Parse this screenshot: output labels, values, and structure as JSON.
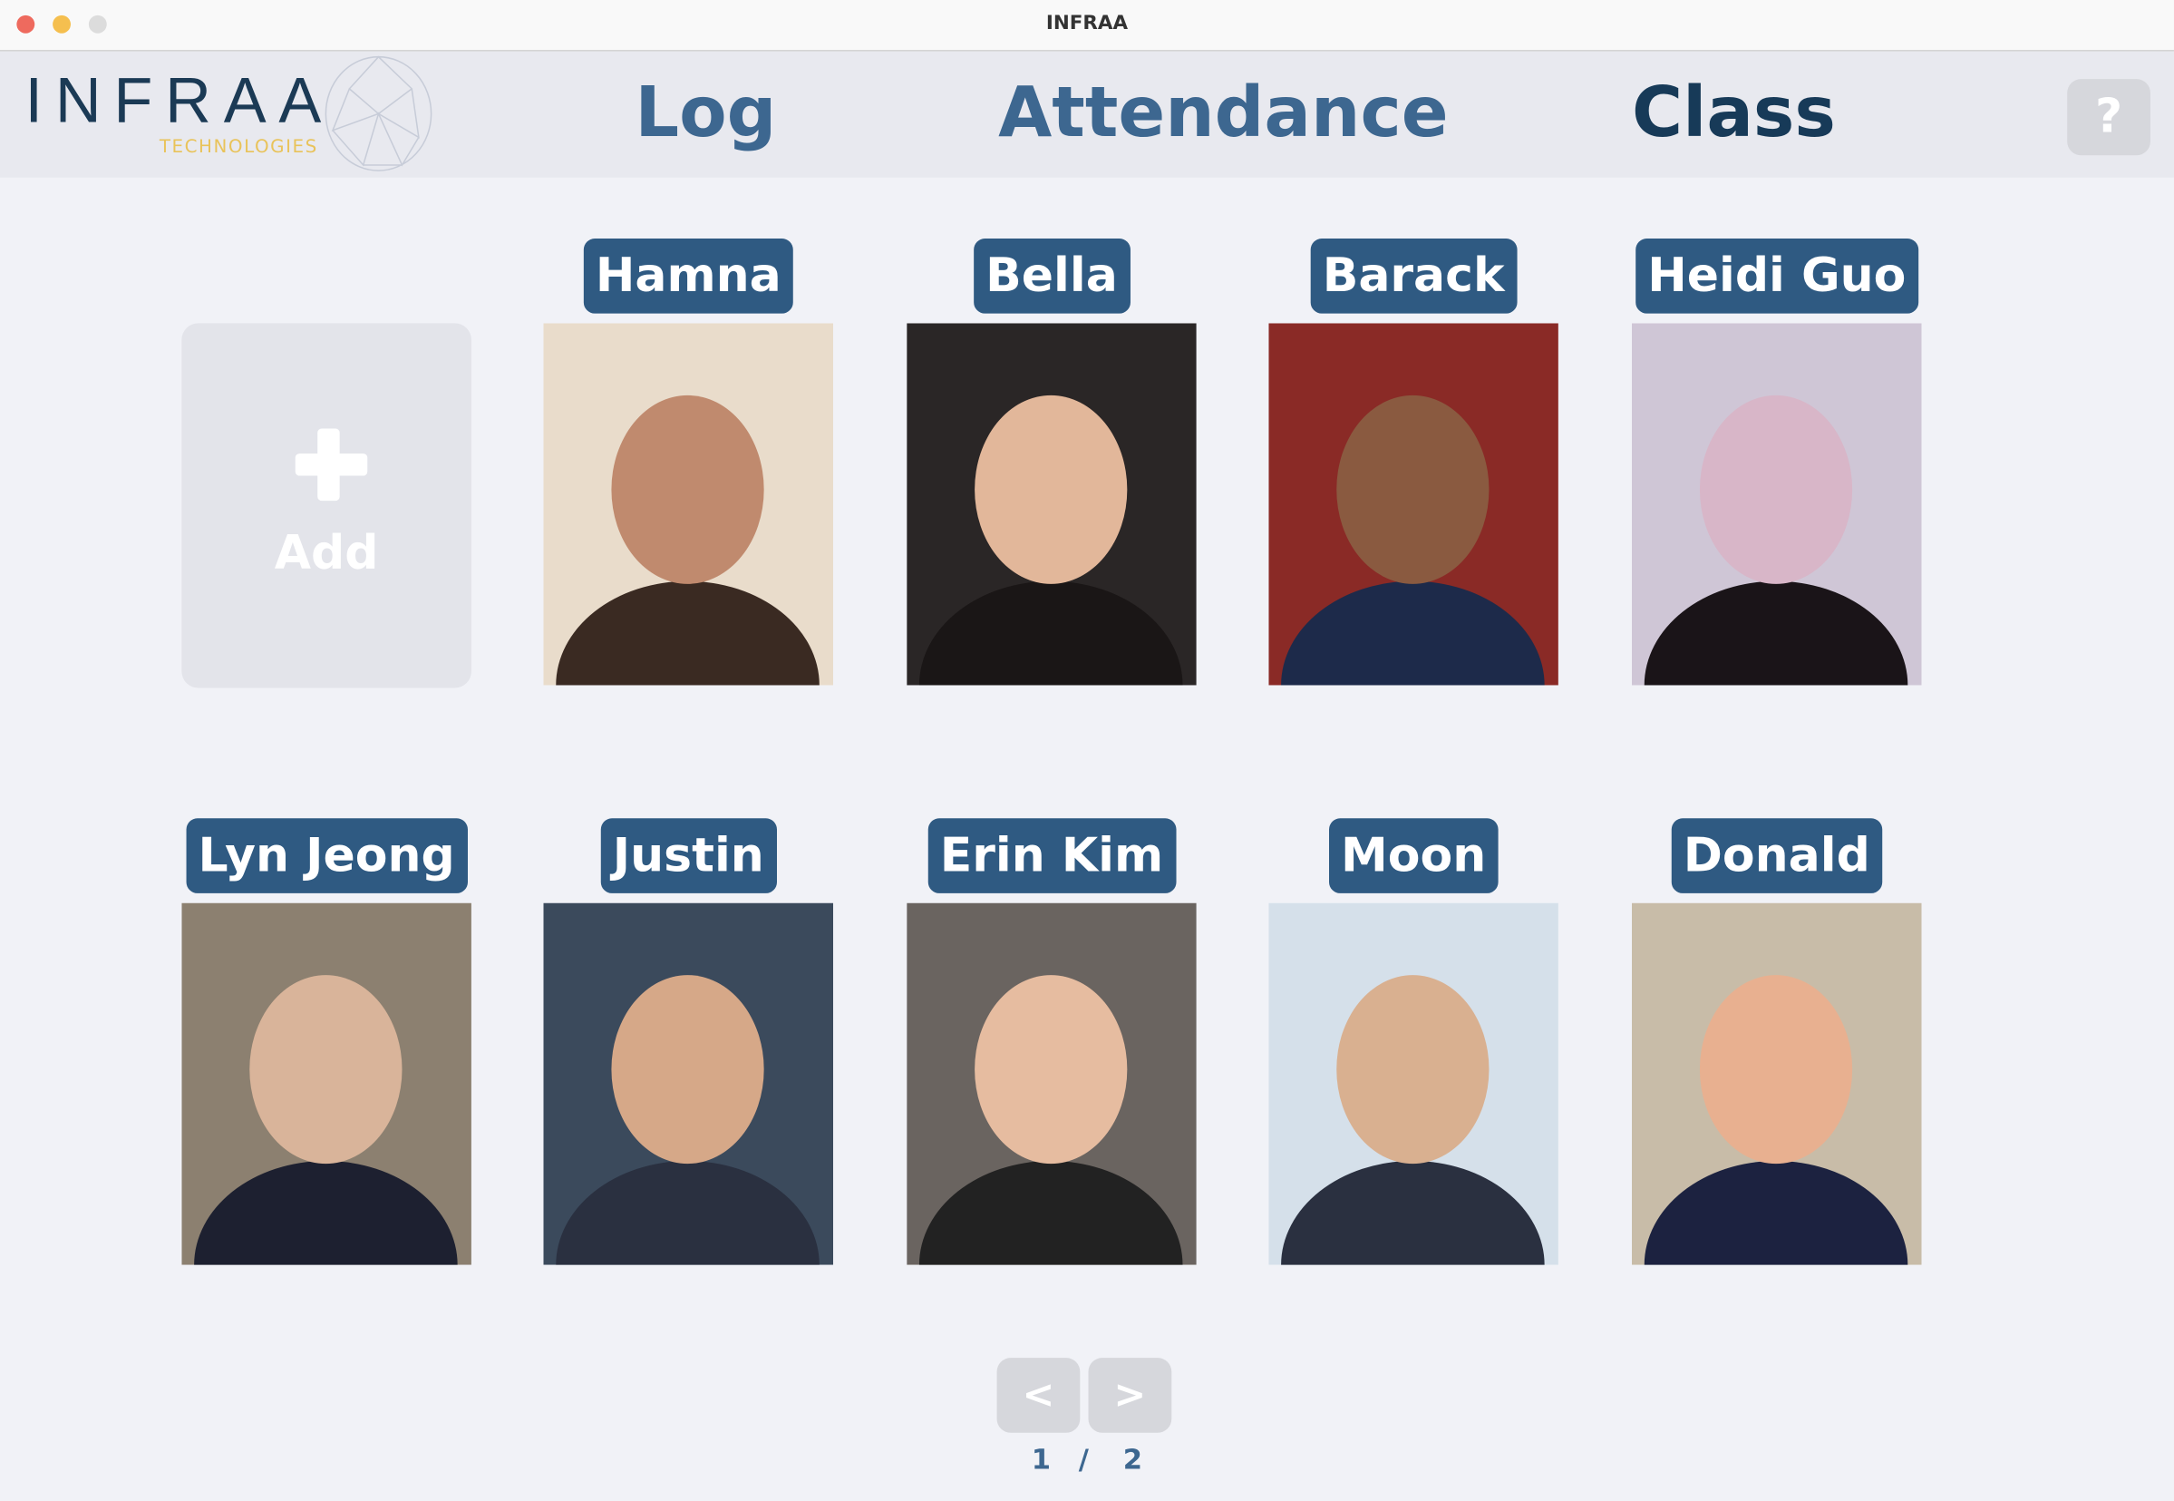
{
  "window": {
    "title": "INFRAA"
  },
  "header": {
    "logo": {
      "name": "INFRAA",
      "subtitle": "TECHNOLOGIES"
    },
    "nav": [
      {
        "label": "Log"
      },
      {
        "label": "Attendance"
      },
      {
        "label": "Class",
        "active": true
      }
    ],
    "help_label": "?"
  },
  "colors": {
    "label_bg": "#2f5a82",
    "nav": "#3d6790",
    "nav_active": "#173a58",
    "logo_accent": "#e9c35a"
  },
  "add_card": {
    "label": "Add",
    "icon": "plus-icon"
  },
  "students": [
    {
      "name": "Hamna"
    },
    {
      "name": "Bella"
    },
    {
      "name": "Barack"
    },
    {
      "name": "Heidi Guo"
    },
    {
      "name": "Lyn Jeong"
    },
    {
      "name": "Justin"
    },
    {
      "name": "Erin Kim"
    },
    {
      "name": "Moon"
    },
    {
      "name": "Donald"
    }
  ],
  "pagination": {
    "prev": "<",
    "next": ">",
    "current": "1",
    "separator": "/",
    "total": "2"
  }
}
